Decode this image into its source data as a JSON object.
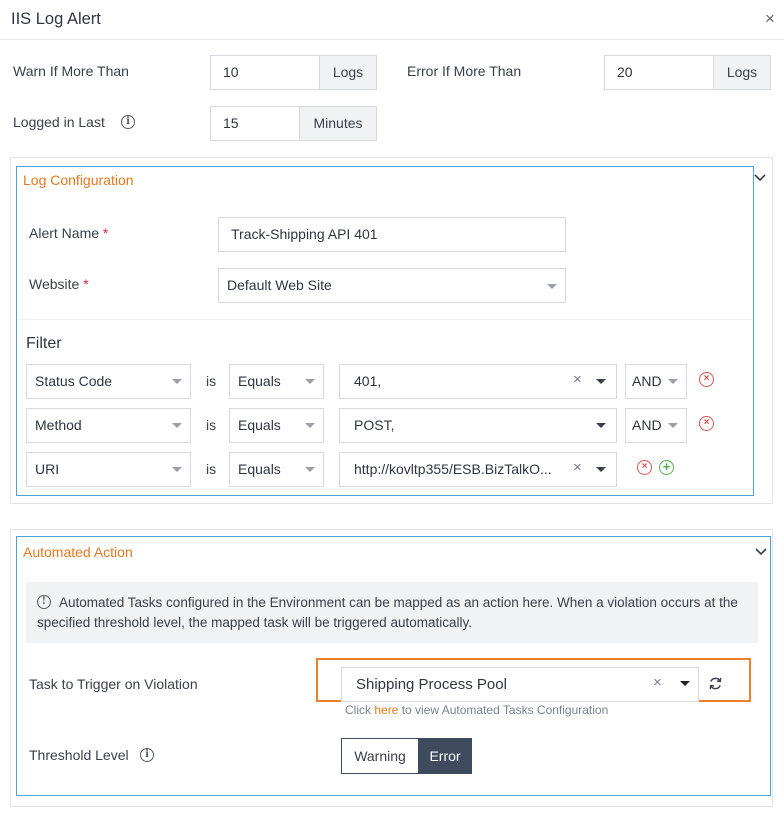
{
  "dialog": {
    "title": "IIS Log Alert",
    "close_glyph": "×"
  },
  "thresholds": {
    "warn_label": "Warn If More Than",
    "warn_value": "10",
    "warn_unit": "Logs",
    "error_label": "Error If More Than",
    "error_value": "20",
    "error_unit": "Logs",
    "logged_label": "Logged in Last",
    "logged_value": "15",
    "logged_unit": "Minutes"
  },
  "log_config": {
    "title": "Log Configuration",
    "alert_name_label": "Alert Name",
    "alert_name_value": "Track-Shipping API 401",
    "website_label": "Website",
    "website_value": "Default Web Site",
    "required_mark": "*",
    "filter_title": "Filter",
    "filters": [
      {
        "field": "Status Code",
        "is": "is",
        "operator": "Equals",
        "value": "401,",
        "joiner": "AND"
      },
      {
        "field": "Method",
        "is": "is",
        "operator": "Equals",
        "value": "POST,",
        "joiner": "AND"
      },
      {
        "field": "URI",
        "is": "is",
        "operator": "Equals",
        "value": "http://kovltp355/ESB.BizTalkO..."
      }
    ]
  },
  "automated_action": {
    "title": "Automated Action",
    "notice": "Automated Tasks configured in the Environment can be mapped as an action here. When a violation occurs at the specified threshold level, the mapped task will be triggered automatically.",
    "task_label": "Task to Trigger on Violation",
    "task_value": "Shipping Process Pool",
    "hint_prefix": "Click",
    "hint_link": "here",
    "hint_suffix": "to view Automated Tasks Configuration",
    "threshold_label": "Threshold Level",
    "threshold_options": [
      "Warning",
      "Error"
    ],
    "threshold_selected": "Error"
  },
  "icons": {
    "info": "info-icon",
    "remove": "remove-circle-icon",
    "add": "add-circle-icon",
    "refresh": "refresh-icon",
    "chevron": "chevron-down-icon"
  },
  "colors": {
    "accent_orange": "#e8771e",
    "panel_border_blue": "#49a6d4",
    "selected_segment": "#3e4a5e",
    "remove_red": "#d9534f",
    "add_green": "#4caf50"
  }
}
